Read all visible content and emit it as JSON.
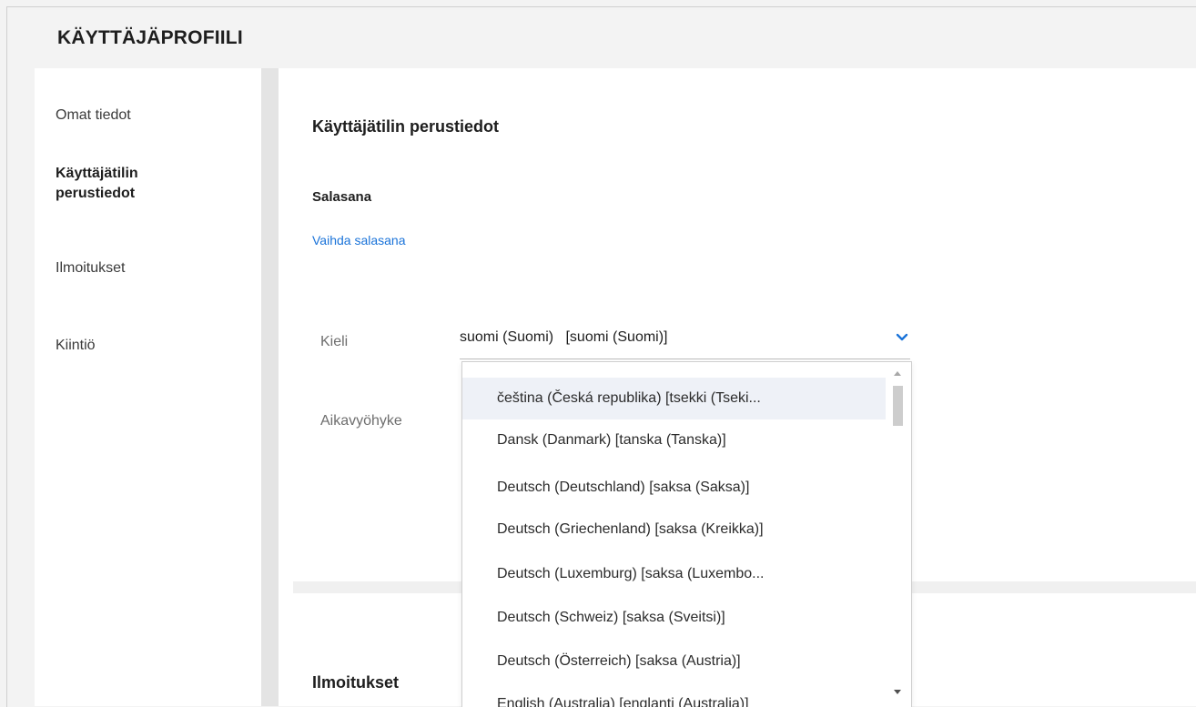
{
  "header": {
    "title": "KÄYTTÄJÄPROFIILI"
  },
  "sidebar": {
    "items": [
      {
        "label": "Omat tiedot",
        "active": false
      },
      {
        "label": "Käyttäjätilin perustiedot",
        "active": true
      },
      {
        "label": "Ilmoitukset",
        "active": false
      },
      {
        "label": "Kiintiö",
        "active": false
      }
    ]
  },
  "main": {
    "section_title": "Käyttäjätilin perustiedot",
    "password": {
      "heading": "Salasana",
      "change_link": "Vaihda salasana"
    },
    "language": {
      "label": "Kieli",
      "value": "suomi (Suomi)   [suomi (Suomi)]"
    },
    "timezone": {
      "label": "Aikavyöhyke"
    },
    "notifications_title": "Ilmoitukset"
  },
  "language_dropdown": {
    "options": [
      "čeština (Česká republika) [tsekki (Tseki...",
      "Dansk (Danmark) [tanska (Tanska)]",
      "Deutsch (Deutschland) [saksa (Saksa)]",
      "Deutsch (Griechenland) [saksa (Kreikka)]",
      "Deutsch (Luxemburg) [saksa (Luxembo...",
      "Deutsch (Schweiz) [saksa (Sveitsi)]",
      "Deutsch (Österreich) [saksa (Austria)]",
      "English (Australia) [englanti (Australia)]"
    ],
    "highlighted_index": 0
  },
  "colors": {
    "accent": "#1a73d9",
    "highlight": "#eef1f7"
  }
}
